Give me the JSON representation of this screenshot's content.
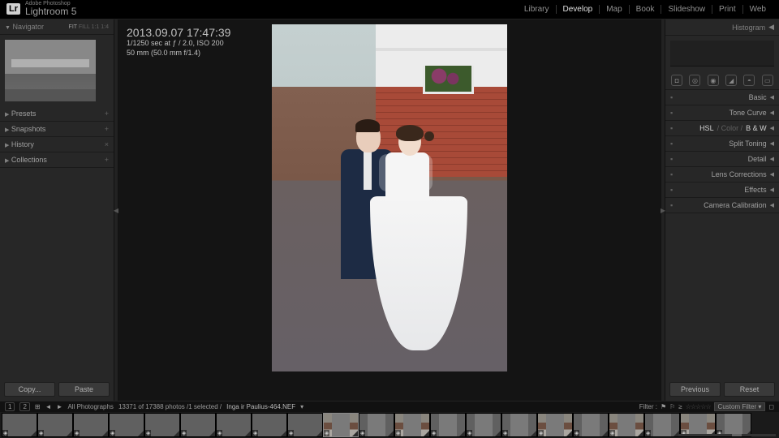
{
  "brand": {
    "sub": "Adobe Photoshop",
    "main": "Lightroom 5",
    "icon": "Lr"
  },
  "modules": [
    "Library",
    "Develop",
    "Map",
    "Book",
    "Slideshow",
    "Print",
    "Web"
  ],
  "active_module": "Develop",
  "left": {
    "navigator": {
      "title": "Navigator",
      "zoom_labels": [
        "FIT",
        "FILL",
        "1:1",
        "1:4"
      ]
    },
    "panels": [
      {
        "label": "Presets",
        "act": "+"
      },
      {
        "label": "Snapshots",
        "act": "+"
      },
      {
        "label": "History",
        "act": "×"
      },
      {
        "label": "Collections",
        "act": "+"
      }
    ],
    "buttons": {
      "copy": "Copy...",
      "paste": "Paste"
    }
  },
  "right": {
    "histogram": "Histogram",
    "tools": [
      "◘",
      "◎",
      "◉",
      "◢",
      "◓",
      "▭"
    ],
    "panels": [
      {
        "label": "Basic"
      },
      {
        "label": "Tone Curve"
      },
      {
        "label": "HSL",
        "extra": [
          "Color",
          "B & W"
        ],
        "active": true
      },
      {
        "label": "Split Toning"
      },
      {
        "label": "Detail"
      },
      {
        "label": "Lens Corrections"
      },
      {
        "label": "Effects"
      },
      {
        "label": "Camera Calibration"
      }
    ],
    "buttons": {
      "previous": "Previous",
      "reset": "Reset"
    }
  },
  "meta": {
    "datetime": "2013.09.07 17:47:39",
    "exposure": "1/1250 sec at ƒ / 2.0, ISO 200",
    "lens": "50 mm (50.0 mm f/1.4)"
  },
  "secondary": {
    "nums": [
      "1",
      "2"
    ],
    "source": "All Photographs",
    "counts": "13371 of 17388 photos  /1 selected /",
    "filename": "Inga ir Paulius-464.NEF",
    "filter_label": "Filter :",
    "stars": "☆☆☆☆☆",
    "filter_select": "Custom Filter"
  },
  "filmstrip": [
    {
      "t": "land"
    },
    {
      "t": "land"
    },
    {
      "t": "land"
    },
    {
      "t": "land"
    },
    {
      "t": "land"
    },
    {
      "t": "land"
    },
    {
      "t": "land"
    },
    {
      "t": "land"
    },
    {
      "t": "land"
    },
    {
      "t": "port",
      "sel": true,
      "col": true
    },
    {
      "t": "port"
    },
    {
      "t": "port",
      "col": true
    },
    {
      "t": "port"
    },
    {
      "t": "port"
    },
    {
      "t": "port"
    },
    {
      "t": "port",
      "col": true
    },
    {
      "t": "port"
    },
    {
      "t": "port",
      "col": true
    },
    {
      "t": "port"
    },
    {
      "t": "port",
      "col": true
    },
    {
      "t": "port"
    }
  ]
}
